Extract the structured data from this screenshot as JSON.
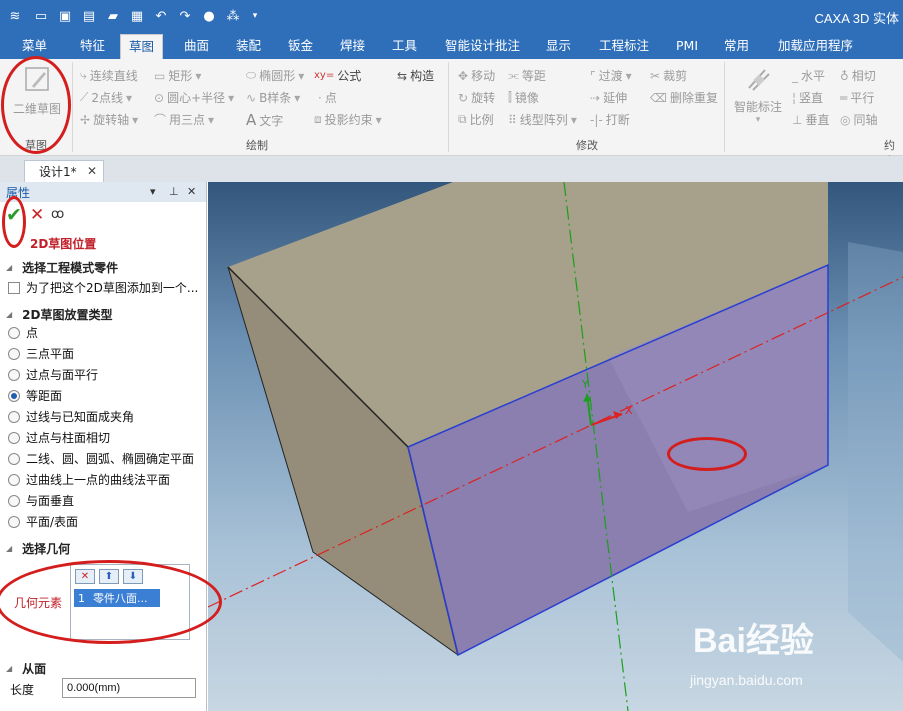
{
  "app": {
    "title": "CAXA 3D 实体",
    "quick_access": [
      "layers-icon",
      "new-icon",
      "open-icon",
      "print-icon",
      "folder-icon",
      "save-icon",
      "undo-icon",
      "redo-icon",
      "render-icon",
      "sparkle-icon",
      "dropdown-icon"
    ]
  },
  "menu": {
    "tabs": [
      "菜单",
      "特征",
      "草图",
      "曲面",
      "装配",
      "钣金",
      "焊接",
      "工具",
      "智能设计批注",
      "显示",
      "工程标注",
      "PMI",
      "常用",
      "加载应用程序"
    ],
    "active": "草图"
  },
  "ribbon": {
    "sketch_group": {
      "big_button": "二维草图",
      "label": "草图"
    },
    "draw_group": {
      "label": "绘制",
      "items": [
        "连续直线",
        "矩形",
        "椭圆形",
        "公式",
        "构造",
        "2点线",
        "圆心+半径",
        "B样条",
        "点",
        "旋转轴",
        "用三点",
        "文字",
        "投影约束"
      ]
    },
    "modify_group": {
      "label": "修改",
      "items": [
        "移动",
        "等距",
        "过渡",
        "裁剪",
        "旋转",
        "镜像",
        "延伸",
        "删除重复",
        "比例",
        "线型阵列",
        "打断"
      ]
    },
    "constraint_group": {
      "label": "约束",
      "big_button": "智能标注",
      "items": [
        "水平",
        "相切",
        "竖直",
        "平行",
        "垂直",
        "同轴"
      ]
    }
  },
  "doc_tab": {
    "label": "设计1*"
  },
  "panel": {
    "title": "属性",
    "heading": "2D草图位置",
    "section_part": "选择工程模式零件",
    "checkbox_label": "为了把这个2D草图添加到一个...",
    "section_type": "2D草图放置类型",
    "options": [
      "点",
      "三点平面",
      "过点与面平行",
      "等距面",
      "过线与已知面成夹角",
      "过点与柱面相切",
      "二线、圆、圆弧、椭圆确定平面",
      "过曲线上一点的曲线法平面",
      "与面垂直",
      "平面/表面"
    ],
    "selected_option": 3,
    "section_geom": "选择几何",
    "geom_label": "几何元素",
    "geom_row": {
      "index": "1",
      "value": "零件八面..."
    },
    "section_from": "从面",
    "length_label": "长度",
    "length_value": "0.000(mm)"
  },
  "viewport": {
    "axis_x": "X",
    "axis_y": "Y"
  },
  "watermark": {
    "brand": "Bai经验",
    "url": "jingyan.baidu.com"
  }
}
